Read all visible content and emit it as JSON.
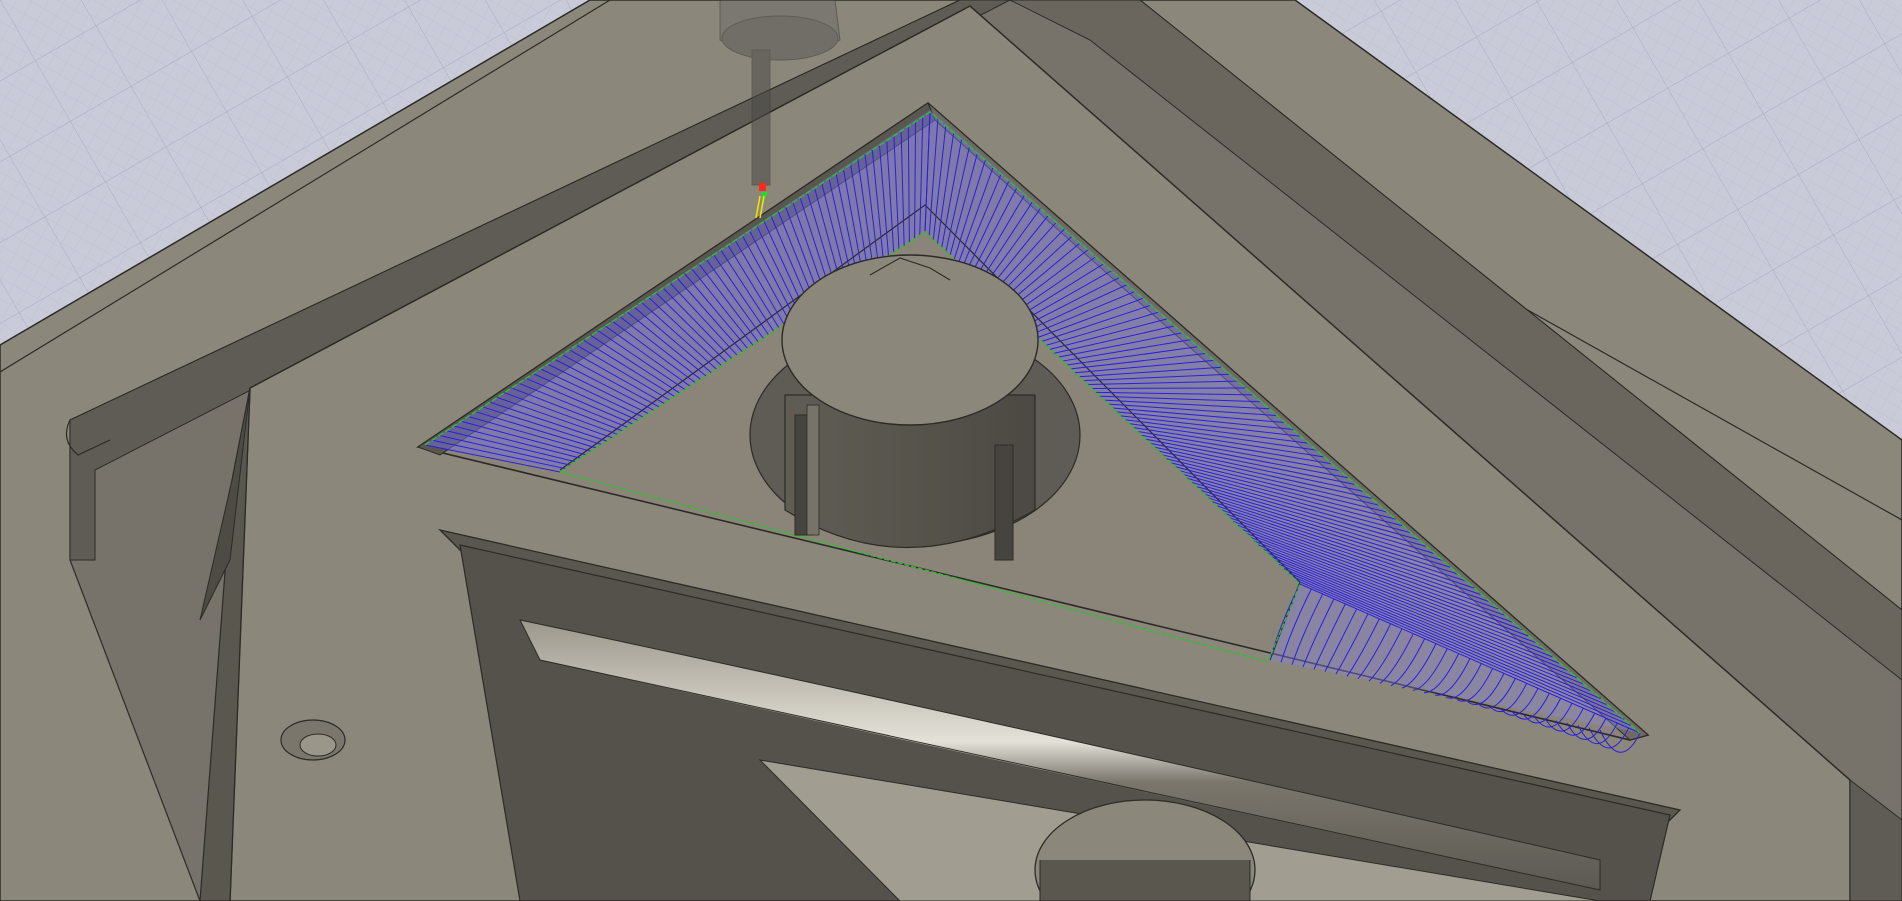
{
  "viewport": {
    "view_mode": "cam-toolpath-simulation",
    "colors": {
      "background": "#c9cbd8",
      "grid_line": "#aeb2c9",
      "stock_top": "#8c877b",
      "stock_wall": "#5f5c55",
      "stock_dark": "#4a4843",
      "edge": "#2c2b28",
      "toolpath_cut": "#2a1fe0",
      "toolpath_link": "#2fbf2f",
      "tool_holder": "#6d6c68",
      "tool_tip_red": "#ff2a1a",
      "tool_tip_green": "#22dd22",
      "tool_tip_yellow": "#f2e600"
    },
    "icons": {
      "tool": "cutting-tool-icon",
      "ground_grid": "grid-plane"
    }
  }
}
